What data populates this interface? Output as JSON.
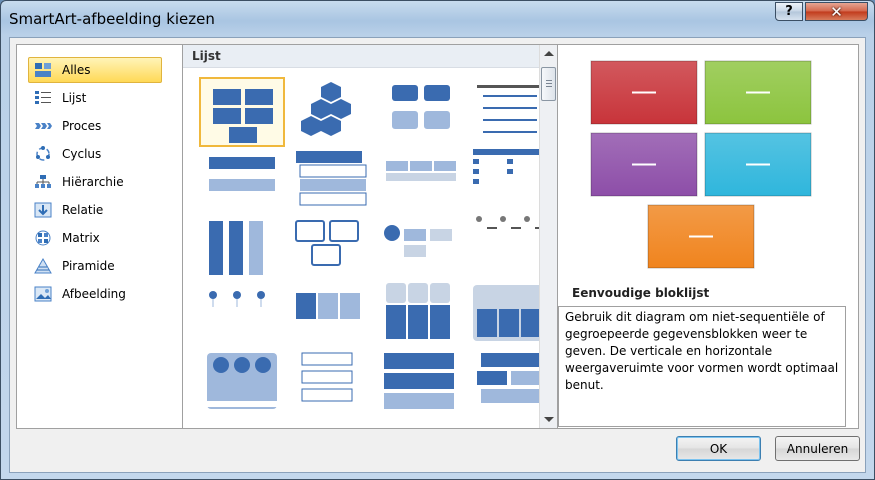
{
  "window": {
    "title": "SmartArt-afbeelding kiezen",
    "help_label": "?",
    "close_label": "✕"
  },
  "categories": [
    {
      "label": "Alles",
      "icon": "all-icon",
      "selected": true
    },
    {
      "label": "Lijst",
      "icon": "list-icon"
    },
    {
      "label": "Proces",
      "icon": "process-icon"
    },
    {
      "label": "Cyclus",
      "icon": "cycle-icon"
    },
    {
      "label": "Hiërarchie",
      "icon": "hierarchy-icon"
    },
    {
      "label": "Relatie",
      "icon": "relationship-icon"
    },
    {
      "label": "Matrix",
      "icon": "matrix-icon"
    },
    {
      "label": "Piramide",
      "icon": "pyramid-icon"
    },
    {
      "label": "Afbeelding",
      "icon": "picture-icon"
    }
  ],
  "gallery": {
    "section_title": "Lijst"
  },
  "preview": {
    "name": "Eenvoudige bloklijst",
    "description": "Gebruik dit diagram om niet-sequentiële of gegroepeerde gegevensblokken weer te geven. De verticale en horizontale weergaveruimte voor vormen wordt optimaal benut.",
    "colors": [
      "#c8343a",
      "#8cc43e",
      "#8d4ea8",
      "#2fb6dc",
      "#f0841e"
    ]
  },
  "buttons": {
    "ok": "OK",
    "cancel": "Annuleren"
  }
}
